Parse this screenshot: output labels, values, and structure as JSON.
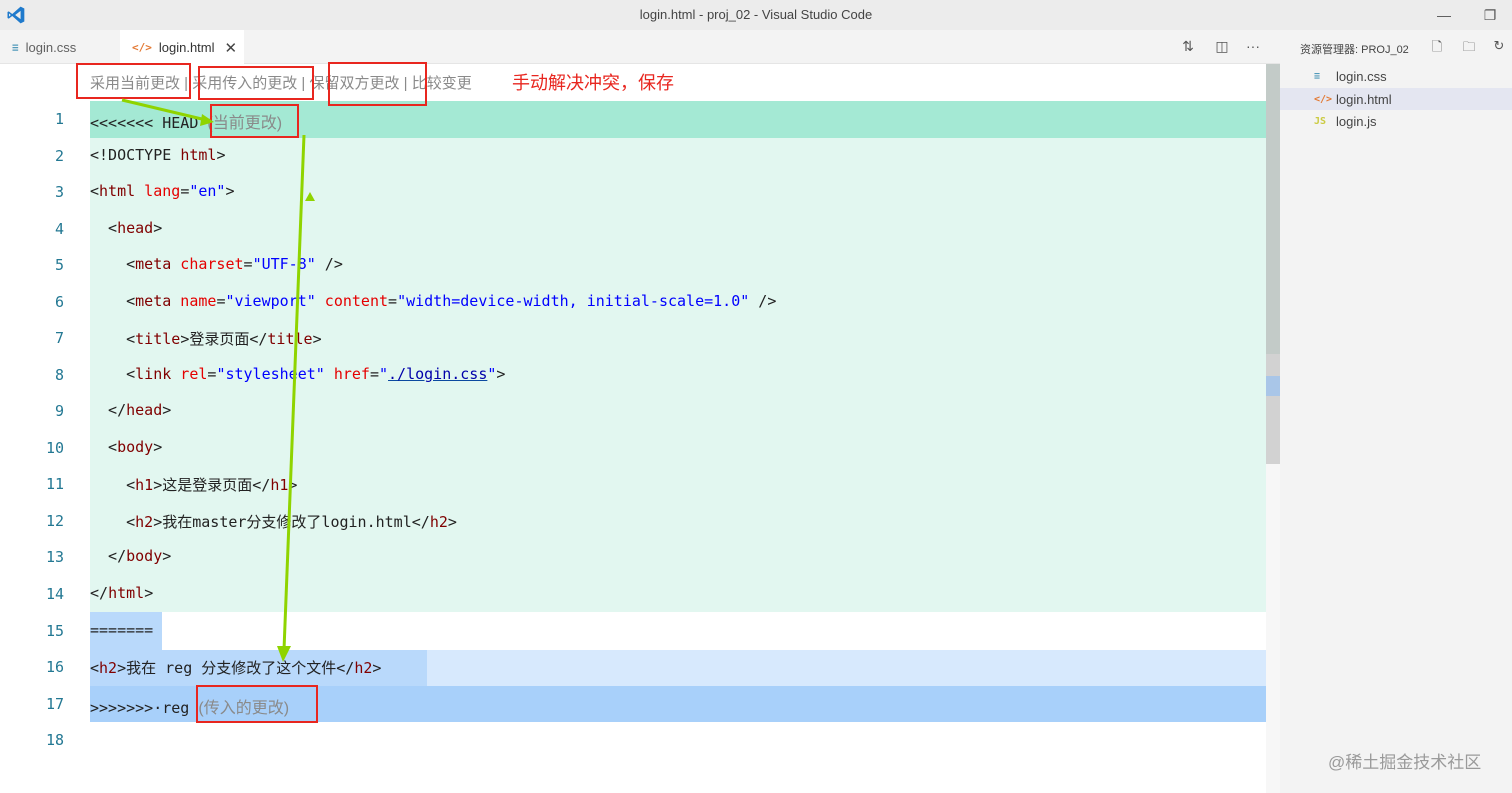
{
  "window": {
    "title": "login.html - proj_02 - Visual Studio Code"
  },
  "tabs": [
    {
      "icon": "≡",
      "label": "login.css"
    },
    {
      "icon": "</>",
      "label": "login.html",
      "close": "✕"
    }
  ],
  "explorer": {
    "title": "资源管理器: PROJ_02",
    "files": [
      {
        "icon": "≡",
        "label": "login.css"
      },
      {
        "icon": "</>",
        "label": "login.html"
      },
      {
        "icon": "JS",
        "label": "login.js"
      }
    ]
  },
  "codelens": {
    "accept_current": "采用当前更改",
    "sep": " | ",
    "accept_incoming": "采用传入的更改",
    "accept_both": "保留双方更改",
    "compare": "比较变更"
  },
  "annotation": {
    "note": "手动解决冲突，保存"
  },
  "watermark": "@稀土掘金技术社区",
  "editor": {
    "lines": [
      {
        "n": "1",
        "marker": "<<<<<<< HEAD",
        "hint": "(当前更改)"
      },
      {
        "n": "2",
        "p1": "<!DOCTYPE ",
        "t1": "html",
        "p2": ">"
      },
      {
        "n": "3",
        "p1": "<",
        "t1": "html",
        "a1": " lang",
        "p2": "=",
        "v1": "\"en\"",
        "p3": ">"
      },
      {
        "n": "4",
        "p1": "  <",
        "t1": "head",
        "p2": ">"
      },
      {
        "n": "5",
        "p1": "    <",
        "t1": "meta",
        "a1": " charset",
        "p2": "=",
        "v1": "\"UTF-8\"",
        "p3": " />"
      },
      {
        "n": "6",
        "p1": "    <",
        "t1": "meta",
        "a1": " name",
        "p2": "=",
        "v1": "\"viewport\"",
        "a2": " content",
        "p3": "=",
        "v2": "\"width=device-width, initial-scale=1.0\"",
        "p4": " />"
      },
      {
        "n": "7",
        "p1": "    <",
        "t1": "title",
        "p2": ">登录页面</",
        "t2": "title",
        "p3": ">"
      },
      {
        "n": "8",
        "p1": "    <",
        "t1": "link",
        "a1": " rel",
        "p2": "=",
        "v1": "\"stylesheet\"",
        "a2": " href",
        "p3": "=",
        "v2": "\"",
        "u1": "./login.css",
        "v3": "\"",
        "p4": ">"
      },
      {
        "n": "9",
        "p1": "  </",
        "t1": "head",
        "p2": ">"
      },
      {
        "n": "10",
        "p1": "  <",
        "t1": "body",
        "p2": ">"
      },
      {
        "n": "11",
        "p1": "    <",
        "t1": "h1",
        "p2": ">这是登录页面</",
        "t2": "h1",
        "p3": ">"
      },
      {
        "n": "12",
        "p1": "    <",
        "t1": "h2",
        "p2": ">我在master分支修改了login.html</",
        "t2": "h2",
        "p3": ">"
      },
      {
        "n": "13",
        "p1": "  </",
        "t1": "body",
        "p2": ">"
      },
      {
        "n": "14",
        "p1": "</",
        "t1": "html",
        "p2": ">"
      },
      {
        "n": "15",
        "marker": "======="
      },
      {
        "n": "16",
        "p1": "<",
        "t1": "h2",
        "p2": ">我在 reg 分支修改了这个文件</",
        "t2": "h2",
        "p3": ">"
      },
      {
        "n": "17",
        "marker": ">>>>>>>·reg",
        "hint": "(传入的更改)"
      },
      {
        "n": "18"
      }
    ]
  },
  "colors": {
    "current_header": "#a4e9d4",
    "current_body": "#e2f7f0",
    "incoming_body": "#d7e9fd",
    "incoming_header": "#a8d0fa",
    "annotation_red": "#e8261f",
    "annotation_arrow": "#8fd400"
  }
}
